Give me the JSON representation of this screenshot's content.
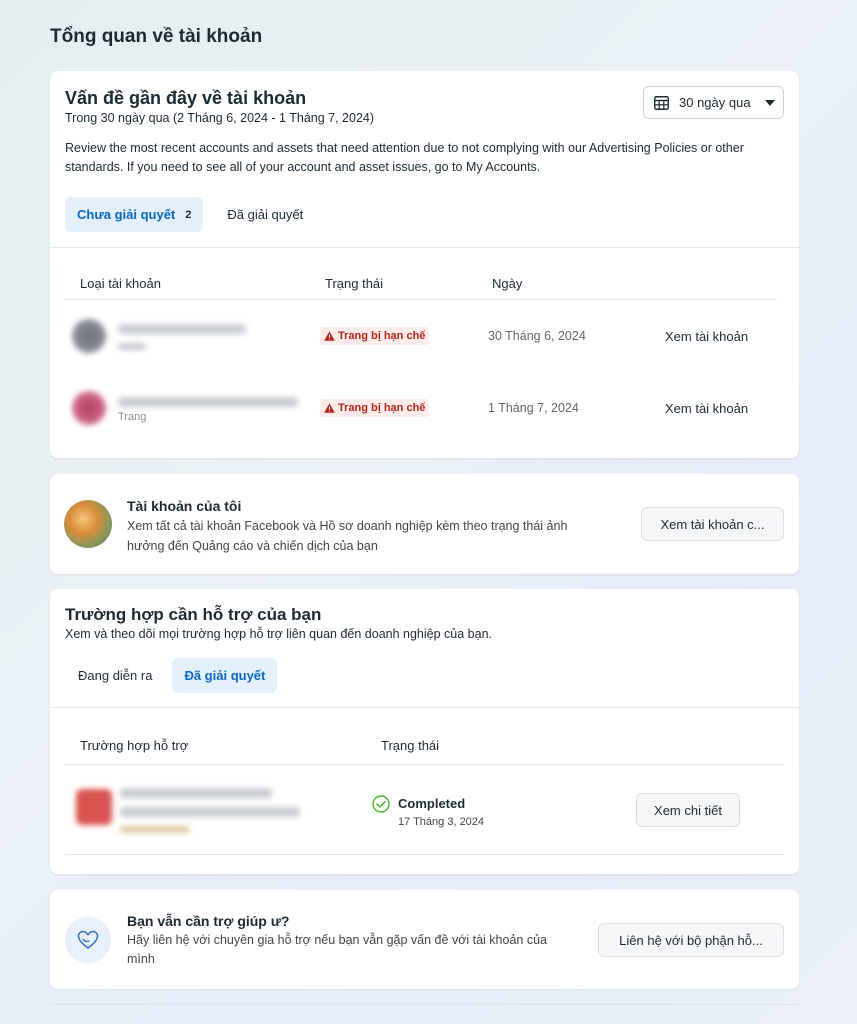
{
  "page": {
    "title": "Tổng quan về tài khoản"
  },
  "issues": {
    "title": "Vấn đề gần đây về tài khoản",
    "subtitle": "Trong 30 ngày qua (2 Tháng 6, 2024 - 1 Tháng 7, 2024)",
    "description": "Review the most recent accounts and assets that need attention due to not complying with our Advertising Policies or other standards. If you need to see all of your account and asset issues, go to My Accounts.",
    "date_range": {
      "icon": "calendar-icon",
      "value": "30 ngày qua"
    },
    "tabs": [
      {
        "label": "Chưa giải quyết",
        "count": "2",
        "active": true
      },
      {
        "label": "Đã giải quyết",
        "active": false
      }
    ],
    "columns": [
      "Loại tài khoản",
      "Trạng thái",
      "Ngày"
    ],
    "rows": [
      {
        "type_label": "",
        "status": "Trang bị hạn chế",
        "date": "30 Tháng 6, 2024",
        "action": "Xem tài khoản"
      },
      {
        "type_label": "Trang",
        "status": "Trang bị hạn chế",
        "date": "1 Tháng 7, 2024",
        "action": "Xem tài khoản"
      }
    ],
    "colors": {
      "warning": "#b3261e",
      "active_tab": "#0a66c2"
    }
  },
  "my_accounts": {
    "title": "Tài khoản của tôi",
    "description": "Xem tất cả tài khoản Facebook và Hồ sơ doanh nghiệp kèm theo trạng thái ảnh hưởng đến Quảng cáo và chiến dịch của bạn",
    "button": "Xem tài khoản c..."
  },
  "support": {
    "title": "Trường hợp cần hỗ trợ của bạn",
    "subtitle": "Xem và theo dõi mọi trường hợp hỗ trợ liên quan đến doanh nghiệp của bạn.",
    "tabs": [
      {
        "label": "Đang diễn ra",
        "active": false
      },
      {
        "label": "Đã giải quyết",
        "active": true
      }
    ],
    "columns": [
      "Trường hợp hỗ trợ",
      "Trạng thái"
    ],
    "rows": [
      {
        "status": "Completed",
        "status_date": "17 Tháng 3, 2024",
        "action": "Xem chi tiết"
      }
    ],
    "colors": {
      "completed": "#42b72a"
    }
  },
  "help": {
    "icon": "heart-icon",
    "title": "Bạn vẫn cần trợ giúp ư?",
    "description": "Hãy liên hệ với chuyên gia hỗ trợ nếu bạn vẫn gặp vấn đề với tài khoản của mình",
    "button": "Liên hệ với bộ phận hỗ..."
  }
}
